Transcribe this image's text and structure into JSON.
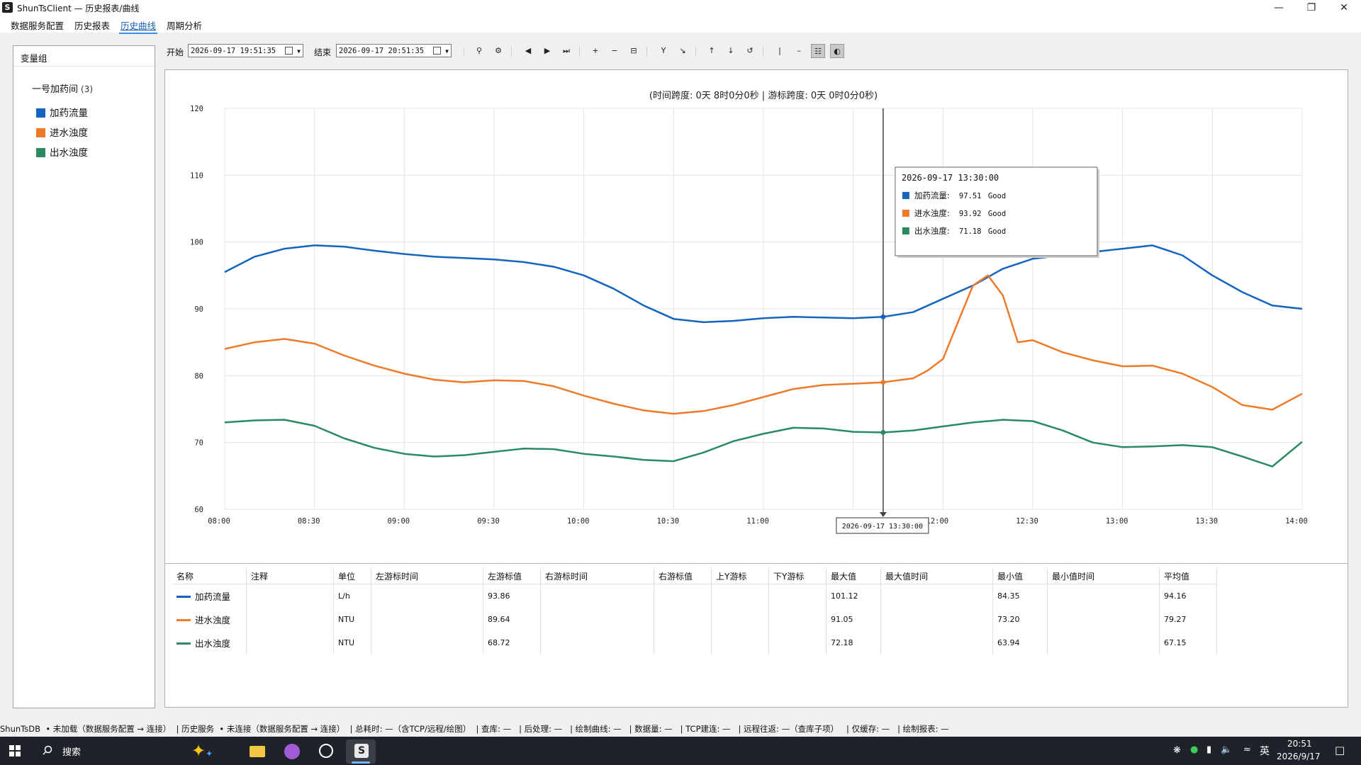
{
  "window": {
    "title": "ShunTsClient — 历史报表/曲线",
    "icon_letter": "S"
  },
  "menu": [
    "数据服务配置",
    "历史报表",
    "历史曲线",
    "周期分析"
  ],
  "left_panel": {
    "header": "变量组",
    "group_name": "一号加药间",
    "group_count": "(3)",
    "items": [
      {
        "label": "加药流量",
        "color": "#1565c0"
      },
      {
        "label": "进水浊度",
        "color": "#ee7a2a"
      },
      {
        "label": "出水浊度",
        "color": "#2a8a62"
      }
    ]
  },
  "toolbar": {
    "start_label": "开始",
    "start_value": "2026-09-17 19:51:35",
    "end_label": "结束",
    "end_value": "2026-09-17 20:51:35"
  },
  "chart_data": {
    "type": "line",
    "title": "(时间跨度: 0天 8时0分0秒  |  游标跨度: 0天 0时0分0秒)",
    "x_ticks": [
      "08:00",
      "08:30",
      "09:00",
      "09:30",
      "10:00",
      "10:30",
      "11:00",
      "11:30",
      "12:00",
      "12:30",
      "13:00",
      "13:30",
      "14:00"
    ],
    "y_ticks": [
      "60",
      "70",
      "80",
      "90",
      "100",
      "110",
      "120"
    ],
    "ylim": [
      60,
      120
    ],
    "xlim": [
      "08:00",
      "14:00"
    ],
    "grid": true,
    "cursor": {
      "time": "2026-09-17 13:30:00",
      "x_value": "11:40"
    },
    "tooltip": {
      "time": "2026-09-17 13:30:00",
      "rows": [
        {
          "label": "加药流量:",
          "value": "97.51",
          "quality": "Good"
        },
        {
          "label": "进水浊度:",
          "value": "93.92",
          "quality": "Good"
        },
        {
          "label": "出水浊度:",
          "value": "71.18",
          "quality": "Good"
        }
      ]
    },
    "series": [
      {
        "name": "加药流量",
        "color": "#1565c0",
        "x": [
          0,
          10,
          20,
          30,
          40,
          50,
          60,
          70,
          80,
          90,
          100,
          110,
          120,
          130,
          140,
          150,
          160,
          170,
          180,
          190,
          200,
          210,
          220,
          230,
          240,
          250,
          260,
          270,
          280,
          290,
          300,
          310,
          320,
          330,
          340,
          350,
          360
        ],
        "values": [
          95.5,
          97.8,
          99.0,
          99.5,
          99.3,
          98.7,
          98.2,
          97.8,
          97.6,
          97.4,
          97.0,
          96.3,
          95.0,
          93.0,
          90.5,
          88.5,
          88.0,
          88.2,
          88.6,
          88.8,
          88.7,
          88.6,
          88.8,
          89.5,
          91.5,
          93.5,
          96.0,
          97.5,
          98.0,
          98.5,
          99.0,
          99.5,
          98.0,
          95.0,
          92.5,
          90.5,
          90.0
        ]
      },
      {
        "name": "进水浊度",
        "color": "#ee7a2a",
        "x": [
          0,
          10,
          20,
          30,
          40,
          50,
          60,
          70,
          80,
          90,
          100,
          110,
          120,
          130,
          140,
          150,
          160,
          170,
          180,
          190,
          200,
          210,
          220,
          230,
          235,
          240,
          245,
          250,
          255,
          260,
          265,
          270,
          280,
          290,
          300,
          310,
          320,
          330,
          340,
          350,
          360
        ],
        "values": [
          84.0,
          85.0,
          85.5,
          84.8,
          83.0,
          81.5,
          80.3,
          79.4,
          79.0,
          79.3,
          79.2,
          78.4,
          77.0,
          75.8,
          74.8,
          74.3,
          74.7,
          75.6,
          76.8,
          78.0,
          78.6,
          78.8,
          79.0,
          79.6,
          80.8,
          82.5,
          88.0,
          93.5,
          95.0,
          92.0,
          85.0,
          85.3,
          83.5,
          82.3,
          81.4,
          81.5,
          80.3,
          78.3,
          75.6,
          74.9,
          77.3
        ]
      },
      {
        "name": "出水浊度",
        "color": "#2a8a62",
        "x": [
          0,
          10,
          20,
          30,
          40,
          50,
          60,
          70,
          80,
          90,
          100,
          110,
          120,
          130,
          140,
          150,
          160,
          170,
          180,
          190,
          200,
          210,
          220,
          230,
          240,
          250,
          260,
          270,
          280,
          290,
          300,
          310,
          320,
          330,
          340,
          350,
          360
        ],
        "values": [
          73.0,
          73.3,
          73.4,
          72.5,
          70.6,
          69.2,
          68.3,
          67.9,
          68.1,
          68.6,
          69.1,
          69.0,
          68.3,
          67.9,
          67.4,
          67.2,
          68.5,
          70.2,
          71.3,
          72.2,
          72.1,
          71.6,
          71.5,
          71.8,
          72.4,
          73.0,
          73.4,
          73.2,
          71.8,
          70.0,
          69.3,
          69.4,
          69.6,
          69.3,
          67.9,
          66.4,
          70.1
        ]
      }
    ]
  },
  "table": {
    "headers": [
      "名称",
      "注释",
      "单位",
      "左游标时间",
      "左游标值",
      "右游标时间",
      "右游标值",
      "上Y游标",
      "下Y游标",
      "最大值",
      "最大值时间",
      "最小值",
      "最小值时间",
      "平均值"
    ],
    "rows": [
      {
        "name": "加药流量",
        "note": "",
        "unit": "L/h",
        "lt": "",
        "lv": "93.86",
        "rt": "",
        "rv": "",
        "uy": "",
        "dy": "",
        "max": "101.12",
        "maxt": "",
        "min": "84.35",
        "mint": "",
        "avg": "94.16",
        "color": "#1565c0"
      },
      {
        "name": "进水浊度",
        "note": "",
        "unit": "NTU",
        "lt": "",
        "lv": "89.64",
        "rt": "",
        "rv": "",
        "uy": "",
        "dy": "",
        "max": "91.05",
        "maxt": "",
        "min": "73.20",
        "mint": "",
        "avg": "79.27",
        "color": "#ee7a2a"
      },
      {
        "name": "出水浊度",
        "note": "",
        "unit": "NTU",
        "lt": "",
        "lv": "68.72",
        "rt": "",
        "rv": "",
        "uy": "",
        "dy": "",
        "max": "72.18",
        "maxt": "",
        "min": "63.94",
        "mint": "",
        "avg": "67.15",
        "color": "#2a8a62"
      }
    ]
  },
  "status": [
    "ShunTsDB",
    "• 未加载（数据服务配置 → 连接）",
    "| 历史服务",
    "• 未连接（数据服务配置 → 连接）",
    "| 总耗时: —（含TCP/远程/绘图）",
    "| 查库: —",
    "| 后处理: —",
    "| 绘制曲线: —",
    "| 数据量: —",
    "| TCP建连: —",
    "| 远程往返: —（查库子项）",
    "| 仅缓存: —",
    "| 绘制报表: —"
  ],
  "taskbar": {
    "search": "搜索",
    "ime": "英",
    "time": "20:51",
    "date": "2026/9/17"
  }
}
